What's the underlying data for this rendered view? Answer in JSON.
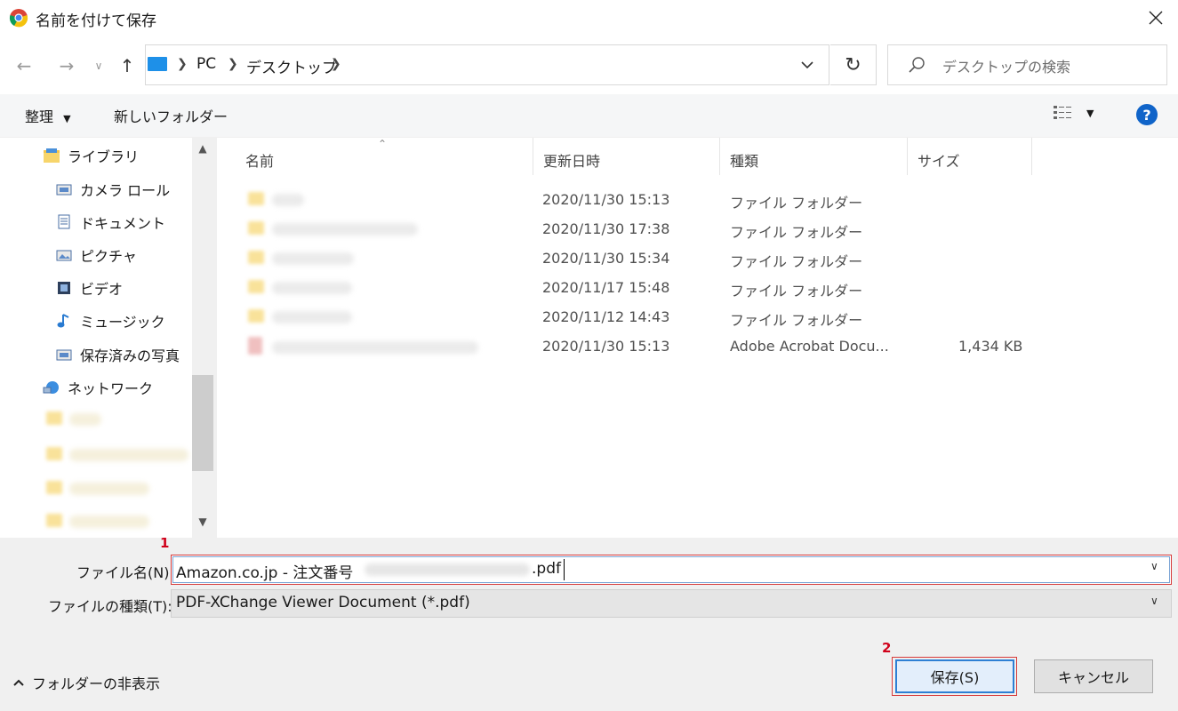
{
  "window": {
    "title": "名前を付けて保存"
  },
  "nav": {
    "breadcrumbs": [
      "PC",
      "デスクトップ"
    ],
    "search_placeholder": "デスクトップの検索"
  },
  "toolbar": {
    "organize": "整理",
    "new_folder": "新しいフォルダー"
  },
  "nav_pane": {
    "items": [
      {
        "label": "ライブラリ",
        "icon": "library-icon"
      },
      {
        "label": "カメラ ロール",
        "icon": "camera-roll-icon"
      },
      {
        "label": "ドキュメント",
        "icon": "document-icon"
      },
      {
        "label": "ピクチャ",
        "icon": "picture-icon"
      },
      {
        "label": "ビデオ",
        "icon": "video-icon"
      },
      {
        "label": "ミュージック",
        "icon": "music-icon"
      },
      {
        "label": "保存済みの写真",
        "icon": "saved-photos-icon"
      },
      {
        "label": "ネットワーク",
        "icon": "network-icon"
      }
    ]
  },
  "file_list": {
    "columns": [
      "名前",
      "更新日時",
      "種類",
      "サイズ"
    ],
    "rows": [
      {
        "date": "2020/11/30 15:13",
        "type": "ファイル フォルダー",
        "size": ""
      },
      {
        "date": "2020/11/30 17:38",
        "type": "ファイル フォルダー",
        "size": ""
      },
      {
        "date": "2020/11/30 15:34",
        "type": "ファイル フォルダー",
        "size": ""
      },
      {
        "date": "2020/11/17 15:48",
        "type": "ファイル フォルダー",
        "size": ""
      },
      {
        "date": "2020/11/12 14:43",
        "type": "ファイル フォルダー",
        "size": ""
      },
      {
        "date": "2020/11/30 15:13",
        "type": "Adobe Acrobat Docu...",
        "size": "1,434 KB"
      }
    ]
  },
  "form": {
    "filename_label": "ファイル名(N):",
    "filename_prefix": "Amazon.co.jp - 注文番号",
    "filename_suffix": ".pdf",
    "filetype_label": "ファイルの種類(T):",
    "filetype_value": "PDF-XChange Viewer Document (*.pdf)"
  },
  "annotations": {
    "marker1": "1",
    "marker2": "2",
    "color": "#d0021b"
  },
  "footer": {
    "hide_folders": "フォルダーの非表示",
    "save": "保存(S)",
    "cancel": "キャンセル"
  }
}
